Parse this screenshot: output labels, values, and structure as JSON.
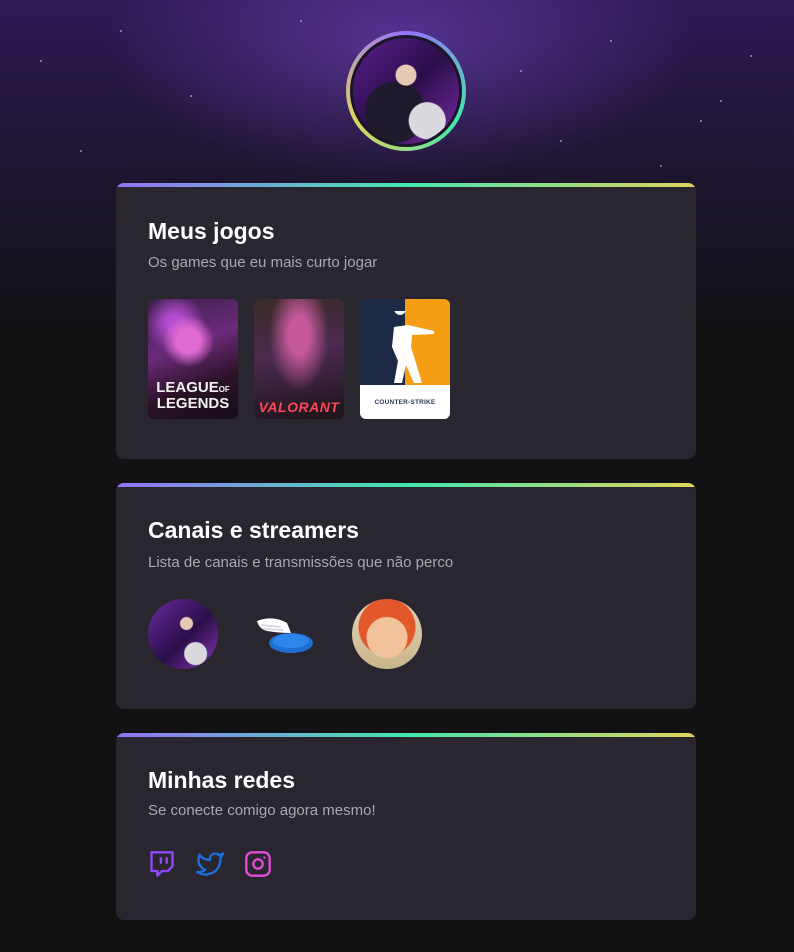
{
  "profile": {
    "avatar_alt": ""
  },
  "games": {
    "title": "Meus jogos",
    "subtitle": "Os games que eu mais curto jogar",
    "items": [
      {
        "name": "League of Legends",
        "label_line1": "LEAGUE",
        "label_of": "OF",
        "label_line2": "LEGENDS"
      },
      {
        "name": "Valorant",
        "label": "VALORANT"
      },
      {
        "name": "Counter-Strike",
        "label": "COUNTER-STRIKE"
      }
    ]
  },
  "streams": {
    "title": "Canais e streamers",
    "subtitle": "Lista de canais e transmissões que não perco"
  },
  "social": {
    "title": "Minhas redes",
    "subtitle": "Se conecte comigo agora mesmo!",
    "items": [
      {
        "icon": "twitch-icon",
        "color": "#9147ff"
      },
      {
        "icon": "twitter-icon",
        "color": "#1d6fe0"
      },
      {
        "icon": "instagram-icon",
        "color": "#e44bd6"
      }
    ]
  },
  "colors": {
    "background": "#121214",
    "card": "#29262f",
    "accent_gradient": [
      "#9572fc",
      "#43e7ad",
      "#e2d45c"
    ],
    "subtitle_text": "#a8a8b3"
  }
}
